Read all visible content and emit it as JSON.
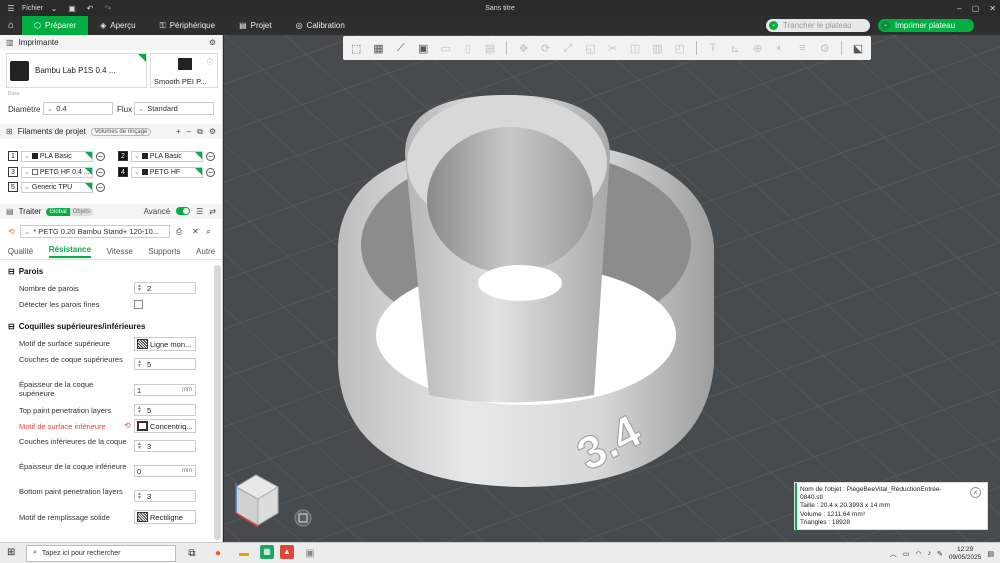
{
  "window": {
    "menu_label": "Fichier",
    "title": "Sans titre"
  },
  "nav": {
    "tabs": [
      {
        "label": "Préparer"
      },
      {
        "label": "Aperçu"
      },
      {
        "label": "Périphérique"
      },
      {
        "label": "Projet"
      },
      {
        "label": "Calibration"
      }
    ],
    "slice_label": "Trancher le plateau",
    "print_label": "Imprimer plateau"
  },
  "printer": {
    "header": "Imprimante",
    "name": "Bambu Lab P1S 0.4 ...",
    "bed": "Smooth PEI P...",
    "bed_hint": "Base",
    "diameter_label": "Diamètre",
    "diameter_value": "0.4",
    "flow_label": "Flux",
    "flow_value": "Standard"
  },
  "filaments": {
    "header": "Filaments de projet",
    "badge": "Volumes de rinçage",
    "items": [
      {
        "num": "1",
        "name": "PLA Basic"
      },
      {
        "num": "2",
        "name": "PLA Basic"
      },
      {
        "num": "3",
        "name": "PETG HF 0,4 ..."
      },
      {
        "num": "4",
        "name": "PETG HF"
      },
      {
        "num": "5",
        "name": "Generic TPU"
      }
    ]
  },
  "process": {
    "header": "Traiter",
    "pill_global": "Global",
    "pill_objects": "Objets",
    "advanced_label": "Avancé",
    "preset": "* PETG 0.20 Bambu Stand+ 120-10...",
    "tabs": [
      "Qualité",
      "Résistance",
      "Vitesse",
      "Supports",
      "Autre"
    ]
  },
  "settings": {
    "walls_group": "Parois",
    "wall_count_label": "Nombre de parois",
    "wall_count_value": "2",
    "thin_walls_label": "Détecter les parois fines",
    "shells_group": "Coquilles supérieures/inférieures",
    "top_pattern_label": "Motif de surface supérieure",
    "top_pattern_value": "Ligne mon...",
    "top_layers_label": "Couches de coque supérieures",
    "top_layers_value": "5",
    "top_thickness_label": "Épaisseur de la coque supérieure",
    "top_thickness_value": "1",
    "top_paint_label": "Top paint penetration layers",
    "top_paint_value": "5",
    "bottom_pattern_label": "Motif de surface inférieure",
    "bottom_pattern_value": "Concentriq...",
    "bottom_layers_label": "Couches inférieures de la coque",
    "bottom_layers_value": "3",
    "bottom_thickness_label": "Épaisseur de la coque inférieure",
    "bottom_thickness_value": "0",
    "bottom_paint_label": "Bottom paint penetration layers",
    "bottom_paint_value": "3",
    "solid_infill_label": "Motif de remplissage solide",
    "solid_infill_value": "Rectiligne",
    "unit_mm": "mm"
  },
  "object_info": {
    "name": "Nom de l'objet : PiègeBeeVital_RéductionEntrée-0840.stl",
    "size": "Taille : 20.4 x 20.3993 x 14 mm",
    "volume": "Volume : 1211.64 mm³",
    "triangles": "Triangles : 18928"
  },
  "model_text": "3.4",
  "taskbar": {
    "search_placeholder": "Tapez ici pour rechercher",
    "time": "12:29",
    "date": "09/05/2025"
  },
  "colors": {
    "accent": "#00ae42",
    "viewport_bg": "#474b4d",
    "warning": "#e0453a"
  }
}
